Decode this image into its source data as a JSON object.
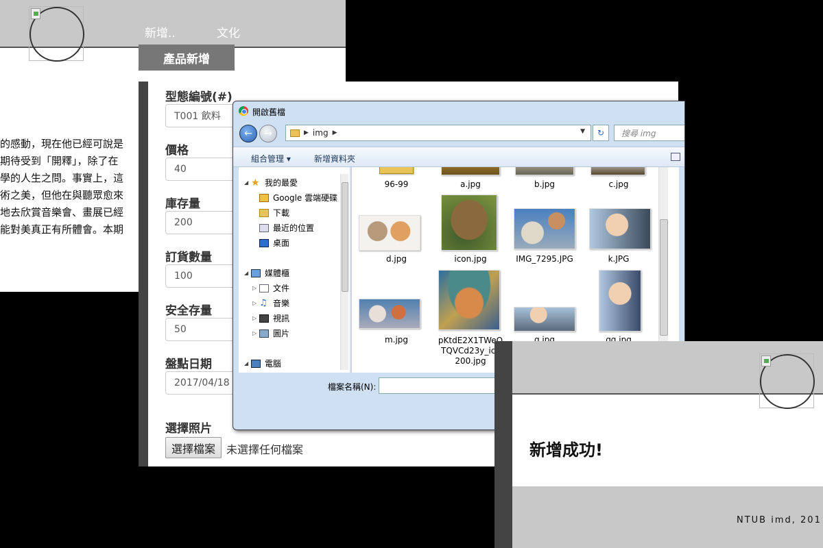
{
  "background_page": {
    "nav": {
      "new_label": "新增..",
      "culture_label": "文化"
    },
    "dropdown_item": "產品新增",
    "article_lines": [
      "的感動，現在他已經可說是",
      "期待受到「開釋」，除了在",
      "學的人生之問。事實上，這",
      "術之美，但他在與聽眾愈來",
      "地去欣賞音樂會、畫展已經",
      "能對美真正有所體會。本期"
    ]
  },
  "form": {
    "type_label": "型態編號(#)",
    "type_value": "T001 飲料",
    "price_label": "價格",
    "price_value": "40",
    "stock_label": "庫存量",
    "stock_value": "200",
    "order_label": "訂貨數量",
    "order_value": "100",
    "safety_label": "安全存量",
    "safety_value": "50",
    "date_label": "盤點日期",
    "date_value": "2017/04/18",
    "photo_label": "選擇照片",
    "choose_file_button": "選擇檔案",
    "file_status": "未選擇任何檔案"
  },
  "dialog": {
    "title": "開啟舊檔",
    "address_path": "img",
    "search_placeholder": "搜尋 img",
    "toolbar": {
      "organize": "組合管理 ▾",
      "new_folder": "新增資料夾"
    },
    "tree": [
      {
        "label": "我的最愛",
        "icon": "star-icon"
      },
      {
        "label": "Google 雲端硬碟",
        "icon": "drive-folder-icon"
      },
      {
        "label": "下載",
        "icon": "downloads-folder-icon"
      },
      {
        "label": "最近的位置",
        "icon": "recent-places-icon"
      },
      {
        "label": "桌面",
        "icon": "desktop-icon"
      },
      {
        "label": "媒體櫃",
        "icon": "library-icon"
      },
      {
        "label": "文件",
        "icon": "document-icon"
      },
      {
        "label": "音樂",
        "icon": "music-icon"
      },
      {
        "label": "視訊",
        "icon": "video-icon"
      },
      {
        "label": "圖片",
        "icon": "pictures-icon"
      },
      {
        "label": "電腦",
        "icon": "computer-icon"
      }
    ],
    "files": [
      "96-99",
      "a.jpg",
      "b.jpg",
      "c.jpg",
      "d.jpg",
      "icon.jpg",
      "IMG_7295.JPG",
      "k.JPG",
      "m.jpg",
      "pKtdE2X1TWeQ TQVCd23y_icc 200.jpg",
      "q.jpg",
      "qq.jpg"
    ],
    "filename_label": "檔案名稱(N):"
  },
  "success_page": {
    "message": "新增成功!",
    "footer": "NTUB imd, 201"
  },
  "colors": {
    "header_gray": "#c8c8c8",
    "dialog_blue": "#cfe0f3",
    "dropdown_gray": "#777777"
  }
}
